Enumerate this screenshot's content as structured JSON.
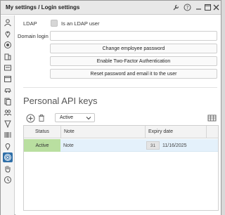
{
  "window": {
    "title": "My settings / Login settings"
  },
  "sidebar": {
    "items": [
      {
        "icon": "user-icon"
      },
      {
        "icon": "location-pin-icon"
      },
      {
        "icon": "target-icon"
      },
      {
        "icon": "building-icon"
      },
      {
        "icon": "id-card-icon"
      },
      {
        "icon": "calendar-icon"
      },
      {
        "icon": "car-icon"
      },
      {
        "icon": "documents-icon"
      },
      {
        "icon": "group-icon"
      },
      {
        "icon": "award-icon"
      },
      {
        "icon": "barcode-icon"
      },
      {
        "icon": "map-pin-icon"
      },
      {
        "icon": "fingerprint-icon"
      },
      {
        "icon": "hand-icon"
      },
      {
        "icon": "clock-icon"
      }
    ],
    "active_index": 12
  },
  "form": {
    "ldap_label": "LDAP",
    "ldap_checkbox_label": "Is an LDAP user",
    "domain_login_label": "Domain login",
    "domain_login_value": "",
    "change_password_label": "Change employee password",
    "two_factor_label": "Enable Two-Factor Authentication",
    "reset_password_label": "Reset password and email it to the user"
  },
  "api_keys": {
    "section_title": "Personal API keys",
    "filter_value": "Active",
    "columns": {
      "status": "Status",
      "note": "Note",
      "expiry": "Expiry date"
    },
    "rows": [
      {
        "status": "Active",
        "note": "Note",
        "day": "31",
        "expiry": "11/16/2025"
      }
    ]
  },
  "colors": {
    "active_sidebar": "#2f6fa8",
    "status_active": "#b9dfa0",
    "selected_row": "#e4f1fb"
  }
}
